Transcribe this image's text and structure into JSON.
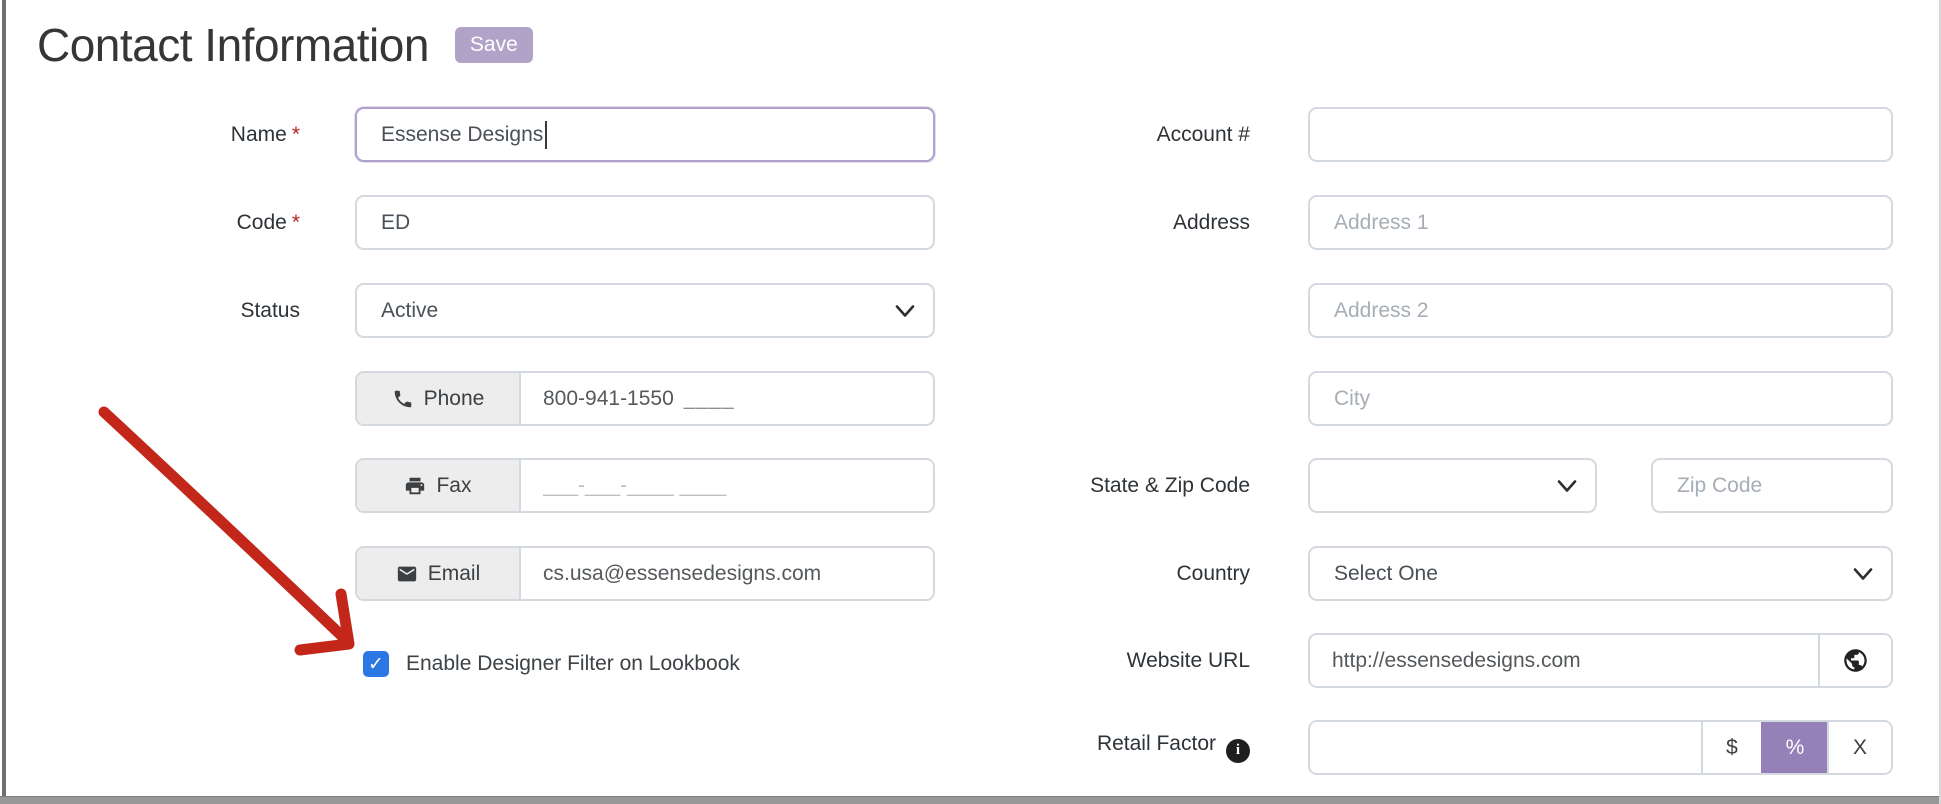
{
  "window": {
    "title": "Contact Information",
    "save_label": "Save",
    "required_marker": "*"
  },
  "colors": {
    "accent_purple": "#9680b8",
    "save_badge_purple": "#b1a3c8",
    "focus_border_purple": "#b0a1cc",
    "checkbox_blue": "#2b78e4",
    "arrow_red": "#c2271a",
    "input_border": "#d3d9de",
    "prepend_bg": "#ededee"
  },
  "icons": {
    "check": "✓",
    "info": "i"
  },
  "left_column": {
    "name": {
      "label": "Name",
      "required": true,
      "value": "Essense Designs"
    },
    "code": {
      "label": "Code",
      "required": true,
      "value": "ED"
    },
    "status": {
      "label": "Status",
      "value": "Active"
    },
    "phone": {
      "label": "Phone",
      "value": "800-941-1550",
      "mask_suffix": "____"
    },
    "fax": {
      "label": "Fax",
      "placeholder": "___-___-____ ____"
    },
    "email": {
      "label": "Email",
      "value": "cs.usa@essensedesigns.com"
    },
    "lookbook": {
      "label": "Enable Designer Filter on Lookbook",
      "checked": true
    }
  },
  "right_column": {
    "account": {
      "label": "Account #",
      "value": ""
    },
    "address": {
      "label": "Address",
      "line1_placeholder": "Address 1",
      "line2_placeholder": "Address 2",
      "city_placeholder": "City"
    },
    "state_zip": {
      "label": "State & Zip Code",
      "state_value": "",
      "zip_placeholder": "Zip Code"
    },
    "country": {
      "label": "Country",
      "value": "Select One"
    },
    "website": {
      "label": "Website URL",
      "value": "http://essensedesigns.com"
    },
    "retail_factor": {
      "label": "Retail Factor",
      "value": "",
      "unit_dollar": "$",
      "unit_percent": "%",
      "unit_clear": "X",
      "selected_unit": "%"
    }
  }
}
